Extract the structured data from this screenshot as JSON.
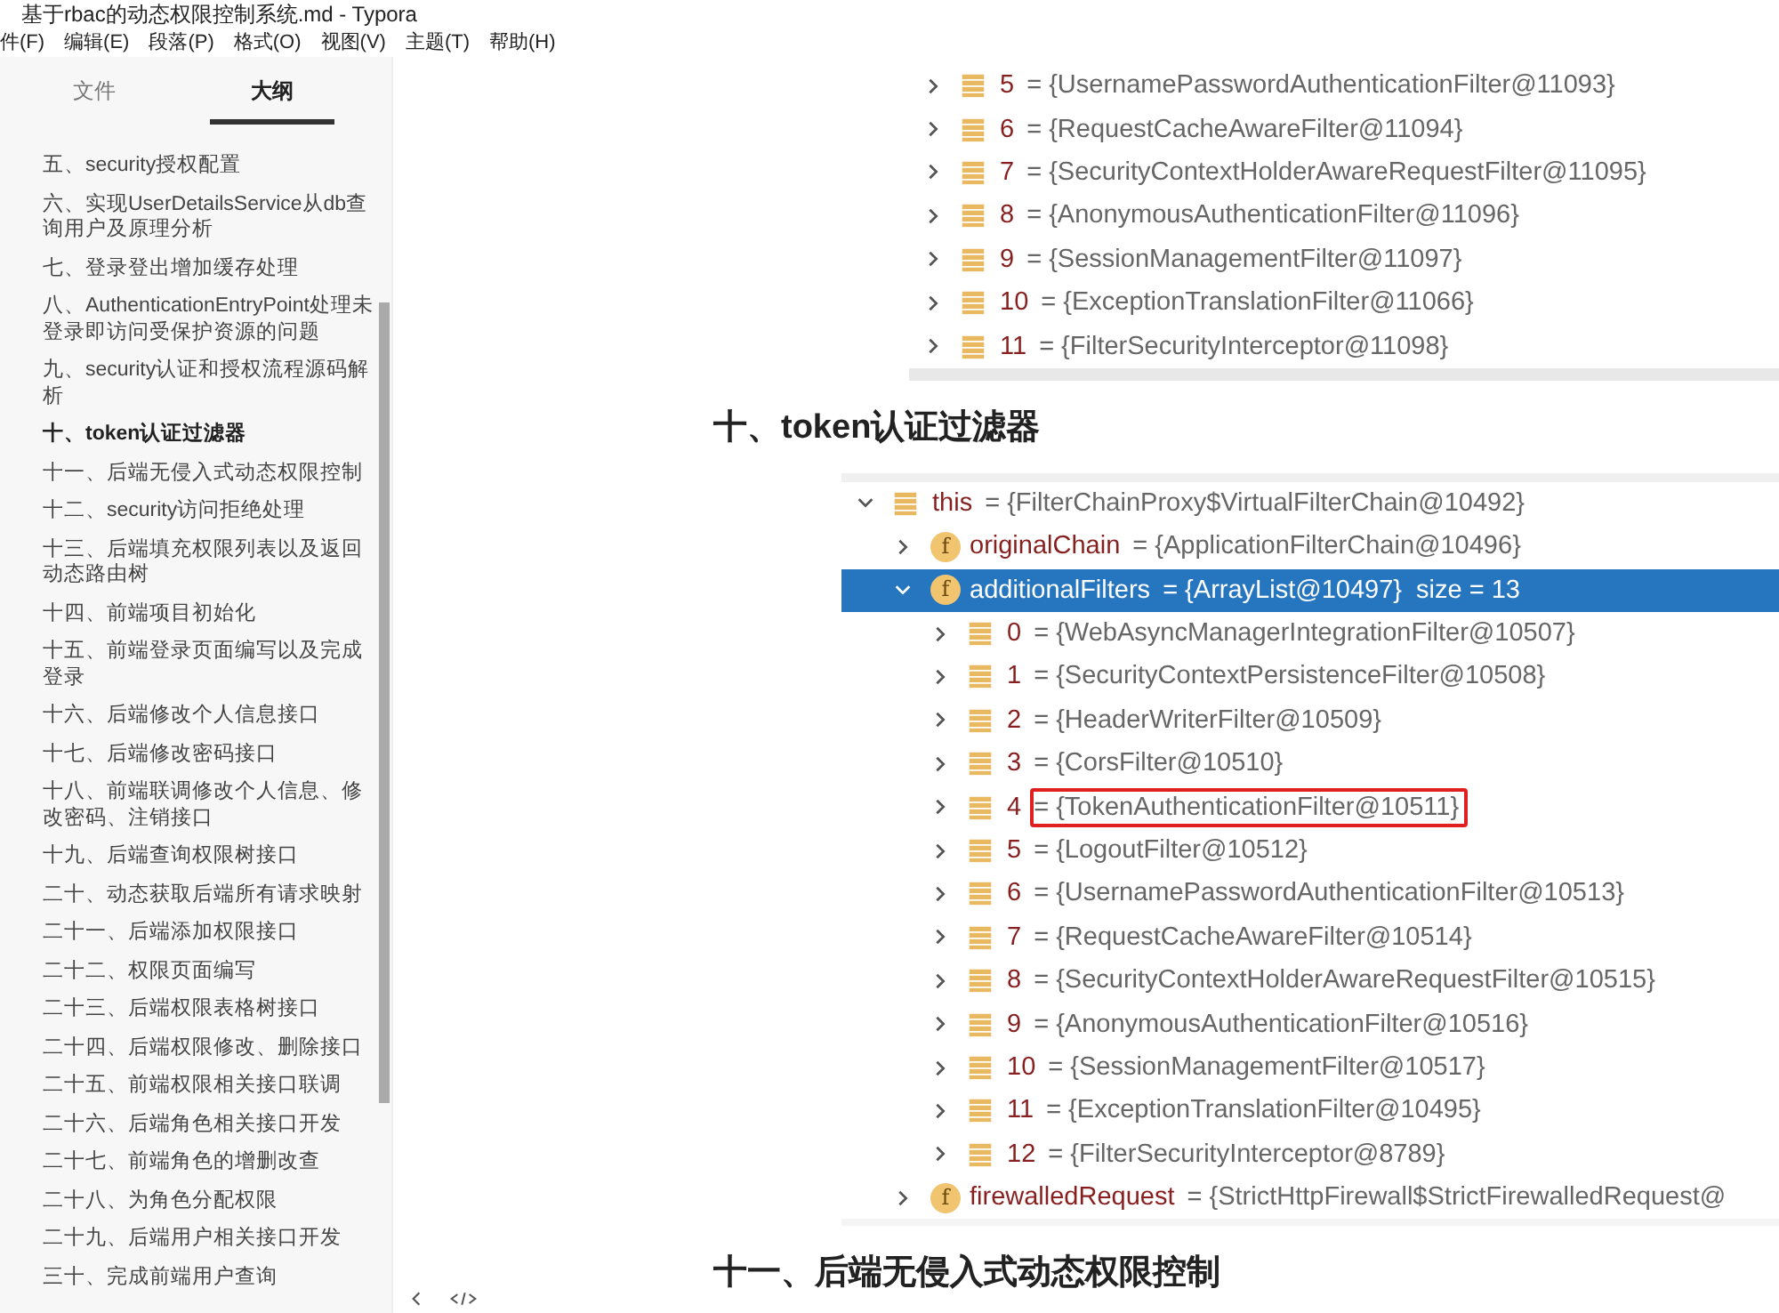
{
  "window": {
    "title": "基于rbac的动态权限控制系统.md - Typora"
  },
  "menu": [
    "件(F)",
    "编辑(E)",
    "段落(P)",
    "格式(O)",
    "视图(V)",
    "主题(T)",
    "帮助(H)"
  ],
  "sidebar": {
    "tabs": [
      {
        "label": "文件",
        "selected": false
      },
      {
        "label": "大纲",
        "selected": true
      }
    ],
    "items": [
      {
        "text": "五、security授权配置",
        "selected": false
      },
      {
        "text": "六、实现UserDetailsService从db查询用户及原理分析",
        "selected": false
      },
      {
        "text": "七、登录登出增加缓存处理",
        "selected": false
      },
      {
        "text": "八、AuthenticationEntryPoint处理未登录即访问受保护资源的问题",
        "selected": false
      },
      {
        "text": "九、security认证和授权流程源码解析",
        "selected": false
      },
      {
        "text": "十、token认证过滤器",
        "selected": true
      },
      {
        "text": "十一、后端无侵入式动态权限控制",
        "selected": false
      },
      {
        "text": "十二、security访问拒绝处理",
        "selected": false
      },
      {
        "text": "十三、后端填充权限列表以及返回动态路由树",
        "selected": false
      },
      {
        "text": "十四、前端项目初始化",
        "selected": false
      },
      {
        "text": "十五、前端登录页面编写以及完成登录",
        "selected": false
      },
      {
        "text": "十六、后端修改个人信息接口",
        "selected": false
      },
      {
        "text": "十七、后端修改密码接口",
        "selected": false
      },
      {
        "text": "十八、前端联调修改个人信息、修改密码、注销接口",
        "selected": false
      },
      {
        "text": "十九、后端查询权限树接口",
        "selected": false
      },
      {
        "text": "二十、动态获取后端所有请求映射",
        "selected": false
      },
      {
        "text": "二十一、后端添加权限接口",
        "selected": false
      },
      {
        "text": "二十二、权限页面编写",
        "selected": false
      },
      {
        "text": "二十三、后端权限表格树接口",
        "selected": false
      },
      {
        "text": "二十四、后端权限修改、删除接口",
        "selected": false
      },
      {
        "text": "二十五、前端权限相关接口联调",
        "selected": false
      },
      {
        "text": "二十六、后端角色相关接口开发",
        "selected": false
      },
      {
        "text": "二十七、前端角色的增删改查",
        "selected": false
      },
      {
        "text": "二十八、为角色分配权限",
        "selected": false
      },
      {
        "text": "二十九、后端用户相关接口开发",
        "selected": false
      },
      {
        "text": "三十、完成前端用户查询",
        "selected": false
      }
    ]
  },
  "document": [
    {
      "kind": "debugger",
      "rows": [
        {
          "kind": "element",
          "name": "5",
          "value": "= {UsernamePasswordAuthenticationFilter@11093}",
          "expanded": false,
          "selected": false,
          "boxed": false
        },
        {
          "kind": "element",
          "name": "6",
          "value": "= {RequestCacheAwareFilter@11094}",
          "expanded": false,
          "selected": false,
          "boxed": false
        },
        {
          "kind": "element",
          "name": "7",
          "value": "= {SecurityContextHolderAwareRequestFilter@11095}",
          "expanded": false,
          "selected": false,
          "boxed": false
        },
        {
          "kind": "element",
          "name": "8",
          "value": "= {AnonymousAuthenticationFilter@11096}",
          "expanded": false,
          "selected": false,
          "boxed": false
        },
        {
          "kind": "element",
          "name": "9",
          "value": "= {SessionManagementFilter@11097}",
          "expanded": false,
          "selected": false,
          "boxed": false
        },
        {
          "kind": "element",
          "name": "10",
          "value": "= {ExceptionTranslationFilter@11066}",
          "expanded": false,
          "selected": false,
          "boxed": false
        },
        {
          "kind": "element",
          "name": "11",
          "value": "= {FilterSecurityInterceptor@11098}",
          "expanded": false,
          "selected": false,
          "boxed": false
        }
      ]
    },
    {
      "kind": "heading",
      "text": "十、token认证过滤器"
    },
    {
      "kind": "debugger",
      "rows": [
        {
          "kind": "element",
          "name": "this",
          "value": "= {FilterChainProxy$VirtualFilterChain@10492}",
          "expanded": true,
          "selected": false,
          "boxed": false,
          "children": [
            {
              "kind": "field",
              "badge": "f",
              "name": "originalChain",
              "value": "= {ApplicationFilterChain@10496}",
              "expanded": false,
              "selected": false,
              "boxed": false
            },
            {
              "kind": "field",
              "badge": "f",
              "name": "additionalFilters",
              "value": "= {ArrayList@10497}  size = 13",
              "expanded": true,
              "selected": true,
              "boxed": false,
              "children": [
                {
                  "kind": "element",
                  "name": "0",
                  "value": "= {WebAsyncManagerIntegrationFilter@10507}",
                  "expanded": false,
                  "selected": false,
                  "boxed": false
                },
                {
                  "kind": "element",
                  "name": "1",
                  "value": "= {SecurityContextPersistenceFilter@10508}",
                  "expanded": false,
                  "selected": false,
                  "boxed": false
                },
                {
                  "kind": "element",
                  "name": "2",
                  "value": "= {HeaderWriterFilter@10509}",
                  "expanded": false,
                  "selected": false,
                  "boxed": false
                },
                {
                  "kind": "element",
                  "name": "3",
                  "value": "= {CorsFilter@10510}",
                  "expanded": false,
                  "selected": false,
                  "boxed": false
                },
                {
                  "kind": "element",
                  "name": "4",
                  "value": "= {TokenAuthenticationFilter@10511}",
                  "expanded": false,
                  "selected": false,
                  "boxed": true
                },
                {
                  "kind": "element",
                  "name": "5",
                  "value": "= {LogoutFilter@10512}",
                  "expanded": false,
                  "selected": false,
                  "boxed": false
                },
                {
                  "kind": "element",
                  "name": "6",
                  "value": "= {UsernamePasswordAuthenticationFilter@10513}",
                  "expanded": false,
                  "selected": false,
                  "boxed": false
                },
                {
                  "kind": "element",
                  "name": "7",
                  "value": "= {RequestCacheAwareFilter@10514}",
                  "expanded": false,
                  "selected": false,
                  "boxed": false
                },
                {
                  "kind": "element",
                  "name": "8",
                  "value": "= {SecurityContextHolderAwareRequestFilter@10515}",
                  "expanded": false,
                  "selected": false,
                  "boxed": false
                },
                {
                  "kind": "element",
                  "name": "9",
                  "value": "= {AnonymousAuthenticationFilter@10516}",
                  "expanded": false,
                  "selected": false,
                  "boxed": false
                },
                {
                  "kind": "element",
                  "name": "10",
                  "value": "= {SessionManagementFilter@10517}",
                  "expanded": false,
                  "selected": false,
                  "boxed": false
                },
                {
                  "kind": "element",
                  "name": "11",
                  "value": "= {ExceptionTranslationFilter@10495}",
                  "expanded": false,
                  "selected": false,
                  "boxed": false
                },
                {
                  "kind": "element",
                  "name": "12",
                  "value": "= {FilterSecurityInterceptor@8789}",
                  "expanded": false,
                  "selected": false,
                  "boxed": false
                }
              ]
            },
            {
              "kind": "field",
              "badge": "f",
              "name": "firewalledRequest",
              "value": "= {StrictHttpFirewall$StrictFirewalledRequest@",
              "expanded": false,
              "selected": false,
              "boxed": false
            }
          ]
        }
      ]
    },
    {
      "kind": "heading",
      "text": "十一、后端无侵入式动态权限控制"
    }
  ]
}
